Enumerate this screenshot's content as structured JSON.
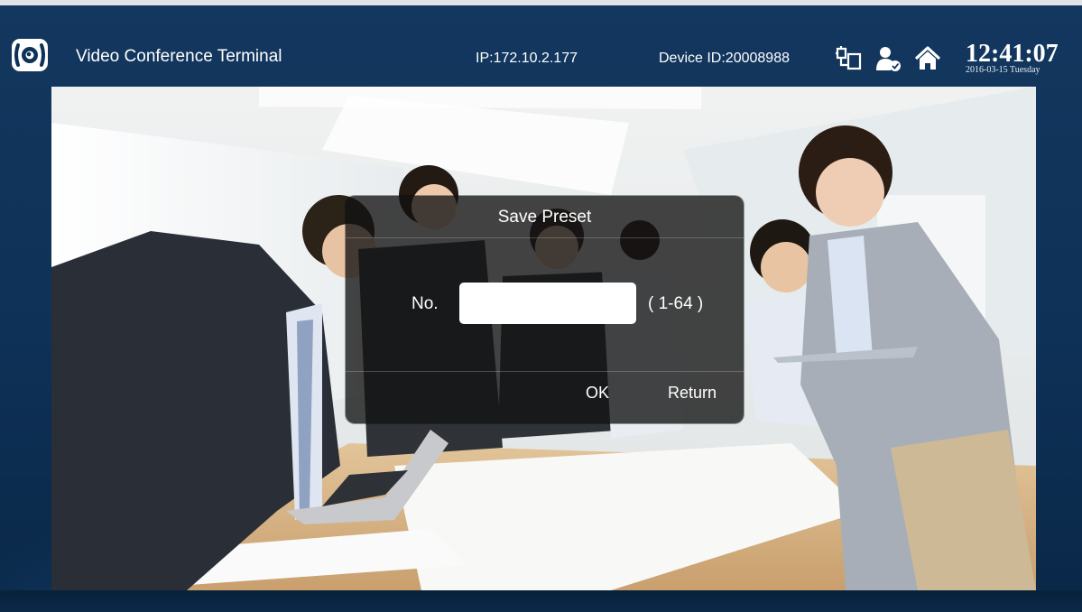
{
  "header": {
    "title": "Video Conference Terminal",
    "ip": "IP:172.10.2.177",
    "device_id": "Device ID:20008988",
    "time": "12:41:07",
    "date": "2016-03-15 Tuesday"
  },
  "icons": {
    "logo": "camera-lens-logo-icon",
    "network": "network-icon",
    "user": "user-settings-icon",
    "home": "home-icon"
  },
  "dialog": {
    "title": "Save Preset",
    "number_label": "No.",
    "number_value": "",
    "number_placeholder": "",
    "range_hint": "( 1-64 )",
    "ok_label": "OK",
    "return_label": "Return"
  },
  "colors": {
    "background": "#0e3157",
    "dialog_overlay": "#121212",
    "text": "#ffffff"
  }
}
